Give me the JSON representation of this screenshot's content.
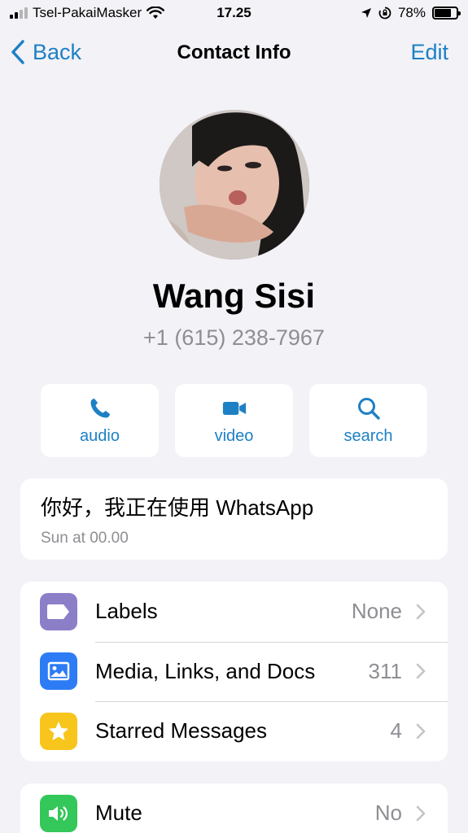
{
  "status_bar": {
    "carrier": "Tsel-PakaiMasker",
    "time": "17.25",
    "battery": "78%",
    "battery_level": 0.78
  },
  "nav": {
    "back_label": "Back",
    "title": "Contact Info",
    "edit_label": "Edit"
  },
  "contact": {
    "name": "Wang Sisi",
    "phone": "+1 (615) 238-7967"
  },
  "actions": [
    {
      "label": "audio",
      "icon": "phone-icon"
    },
    {
      "label": "video",
      "icon": "video-camera-icon"
    },
    {
      "label": "search",
      "icon": "search-icon"
    }
  ],
  "about": {
    "text": "你好，我正在使用 WhatsApp",
    "date": "Sun at 00.00"
  },
  "rows": [
    {
      "label": "Labels",
      "value": "None",
      "icon": "label-tag-icon",
      "color": "#8c7fc8"
    },
    {
      "label": "Media, Links, and Docs",
      "value": "311",
      "icon": "photo-icon",
      "color": "#2d7cf6"
    },
    {
      "label": "Starred Messages",
      "value": "4",
      "icon": "star-icon",
      "color": "#f7c51c"
    }
  ],
  "rows2": [
    {
      "label": "Mute",
      "value": "No",
      "icon": "speaker-icon",
      "color": "#34c759"
    }
  ],
  "colors": {
    "accent": "#1e80c4",
    "background": "#f2f2f7"
  }
}
